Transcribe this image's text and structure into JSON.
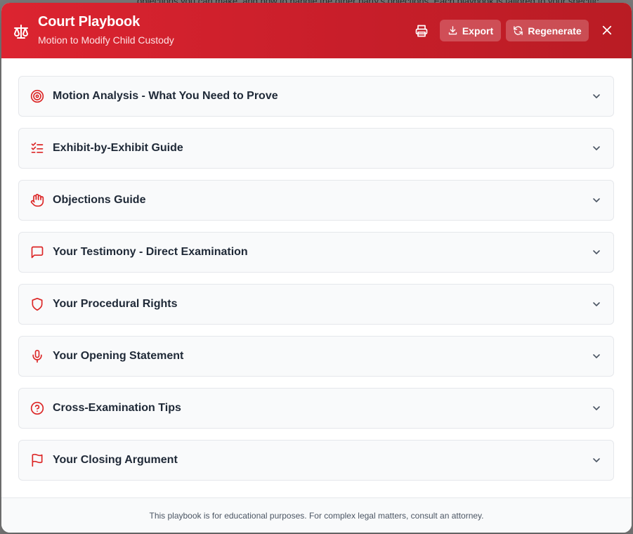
{
  "background": {
    "text": "objections you can make, and how to handle the other party's objections. Each playbook is tailored to your specific"
  },
  "header": {
    "icon": "scale-icon",
    "title": "Court Playbook",
    "subtitle": "Motion to Modify Child Custody",
    "print_icon": "printer-icon",
    "export_label": "Export",
    "regenerate_label": "Regenerate",
    "close_icon": "x-icon",
    "color": "#d01f2a"
  },
  "sections": [
    {
      "label": "Motion Analysis - What You Need to Prove",
      "icon": "target-icon"
    },
    {
      "label": "Exhibit-by-Exhibit Guide",
      "icon": "list-checks-icon"
    },
    {
      "label": "Objections Guide",
      "icon": "hand-icon"
    },
    {
      "label": "Your Testimony - Direct Examination",
      "icon": "message-square-icon"
    },
    {
      "label": "Your Procedural Rights",
      "icon": "shield-icon"
    },
    {
      "label": "Your Opening Statement",
      "icon": "mic-icon"
    },
    {
      "label": "Cross-Examination Tips",
      "icon": "help-circle-icon"
    },
    {
      "label": "Your Closing Argument",
      "icon": "flag-icon"
    }
  ],
  "footer": {
    "text": "This playbook is for educational purposes. For complex legal matters, consult an attorney."
  },
  "colors": {
    "accent": "#dc2626",
    "section_bg": "#f9fafb",
    "section_border": "#e5e7eb",
    "label": "#1f2937"
  }
}
